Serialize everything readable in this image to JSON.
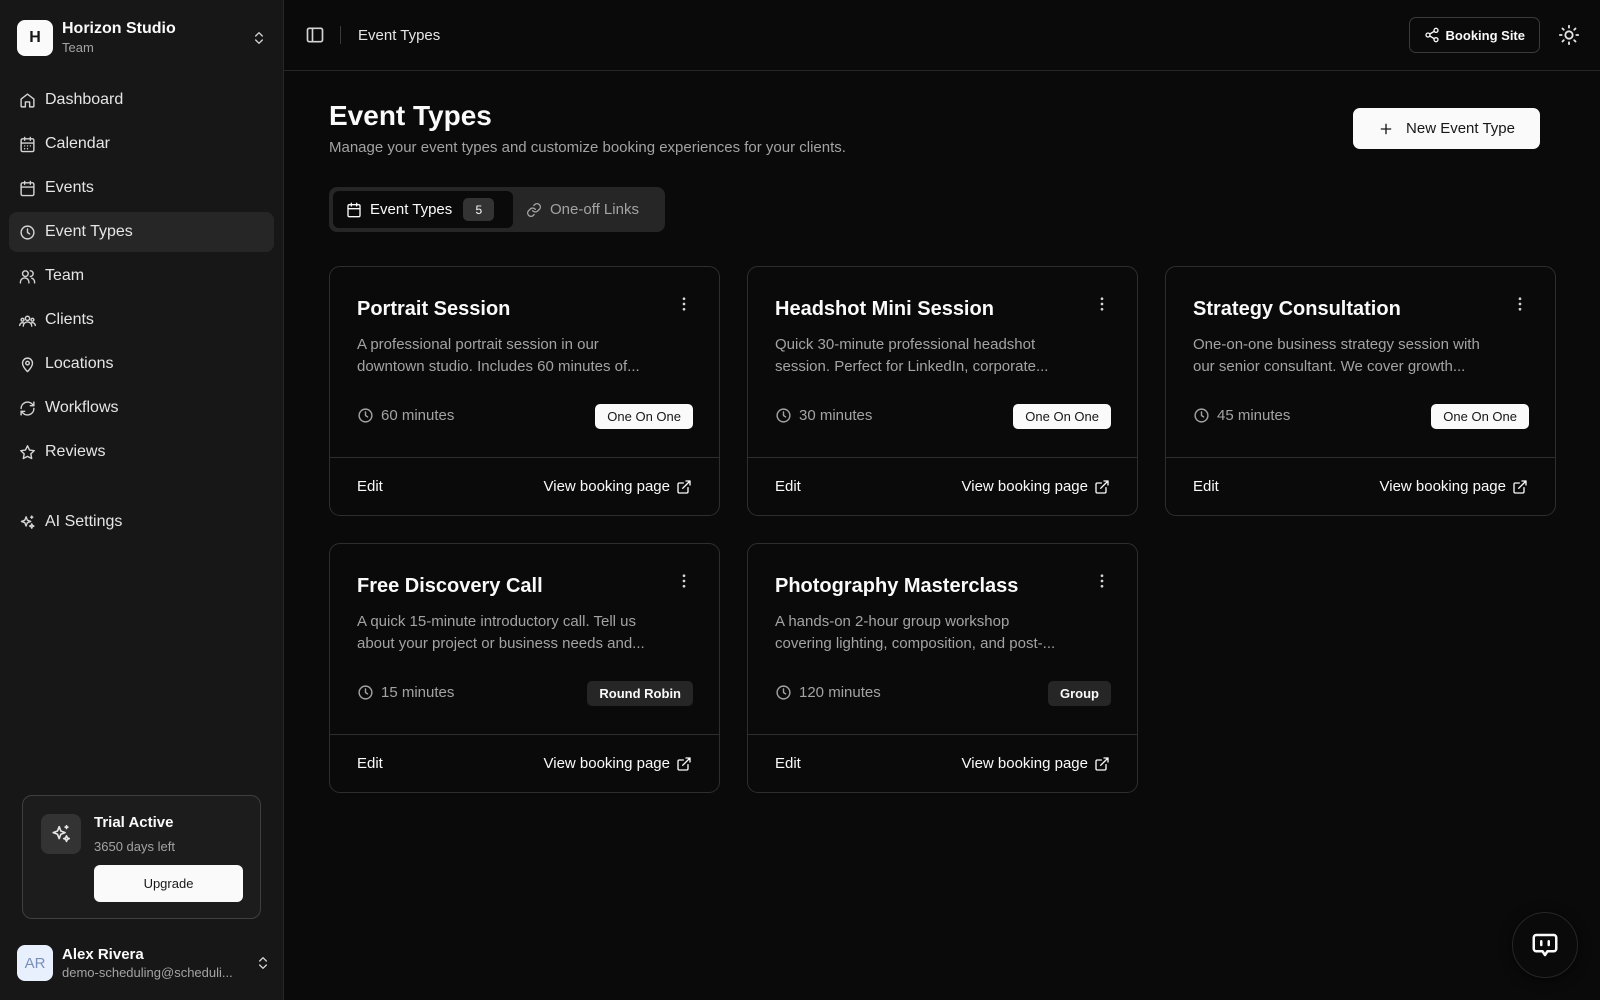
{
  "sidebar": {
    "team": {
      "logo_letter": "H",
      "name": "Horizon Studio",
      "sub": "Team"
    },
    "nav": [
      {
        "label": "Dashboard",
        "icon": "home-icon"
      },
      {
        "label": "Calendar",
        "icon": "calendar-days-icon"
      },
      {
        "label": "Events",
        "icon": "calendar-icon"
      },
      {
        "label": "Event Types",
        "icon": "clock-icon",
        "active": true
      },
      {
        "label": "Team",
        "icon": "users-icon"
      },
      {
        "label": "Clients",
        "icon": "contacts-icon"
      },
      {
        "label": "Locations",
        "icon": "map-pin-icon"
      },
      {
        "label": "Workflows",
        "icon": "refresh-icon"
      },
      {
        "label": "Reviews",
        "icon": "star-icon"
      }
    ],
    "ai_settings": {
      "label": "AI Settings",
      "icon": "sparkles-icon"
    },
    "trial": {
      "title": "Trial Active",
      "days": "3650 days left",
      "upgrade": "Upgrade"
    },
    "user": {
      "initials": "AR",
      "name": "Alex Rivera",
      "email": "demo-scheduling@scheduli..."
    }
  },
  "topbar": {
    "breadcrumb": "Event Types",
    "booking_site": "Booking Site"
  },
  "page": {
    "title": "Event Types",
    "description": "Manage your event types and customize booking experiences for your clients.",
    "new_button": "New Event Type"
  },
  "tabs": [
    {
      "label": "Event Types",
      "count": "5",
      "active": true
    },
    {
      "label": "One-off Links"
    }
  ],
  "cards": [
    {
      "title": "Portrait Session",
      "desc_line1": "A professional portrait session in our",
      "desc_line2": "downtown studio. Includes 60 minutes of...",
      "duration": "60 minutes",
      "badge": "One On One",
      "badge_style": "light",
      "edit": "Edit",
      "view": "View booking page"
    },
    {
      "title": "Headshot Mini Session",
      "desc_line1": "Quick 30-minute professional headshot",
      "desc_line2": "session. Perfect for LinkedIn, corporate...",
      "duration": "30 minutes",
      "badge": "One On One",
      "badge_style": "light",
      "edit": "Edit",
      "view": "View booking page"
    },
    {
      "title": "Strategy Consultation",
      "desc_line1": "One-on-one business strategy session with",
      "desc_line2": "our senior consultant. We cover growth...",
      "duration": "45 minutes",
      "badge": "One On One",
      "badge_style": "light",
      "edit": "Edit",
      "view": "View booking page"
    },
    {
      "title": "Free Discovery Call",
      "desc_line1": "A quick 15-minute introductory call. Tell us",
      "desc_line2": "about your project or business needs and...",
      "duration": "15 minutes",
      "badge": "Round Robin",
      "badge_style": "dark",
      "edit": "Edit",
      "view": "View booking page"
    },
    {
      "title": "Photography Masterclass",
      "desc_line1": "A hands-on 2-hour group workshop",
      "desc_line2": "covering lighting, composition, and post-...",
      "duration": "120 minutes",
      "badge": "Group",
      "badge_style": "dark",
      "edit": "Edit",
      "view": "View booking page"
    }
  ],
  "colors": {
    "background": "#0a0a0a",
    "sidebar": "#171717",
    "accent": "#fafafa",
    "muted_text": "#a3a3a3"
  }
}
